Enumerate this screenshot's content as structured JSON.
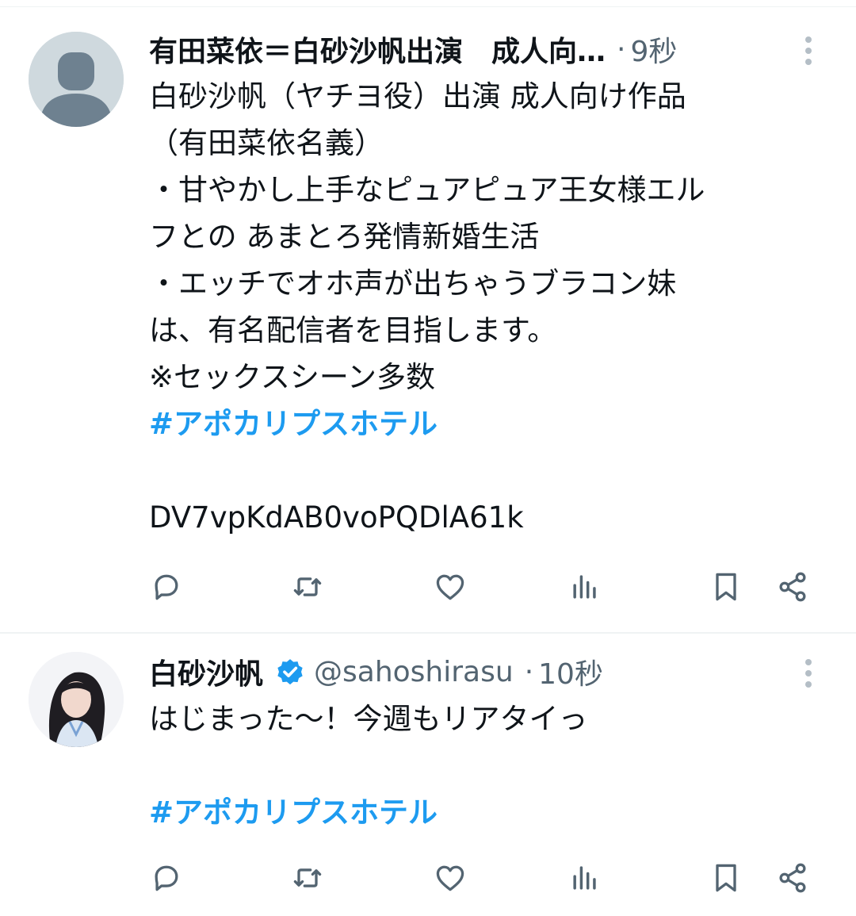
{
  "posts": [
    {
      "author": {
        "display_name": "有田菜依＝白砂沙帆出演　成人向…",
        "handle": "",
        "verified": false,
        "avatar": "default-avatar"
      },
      "separator": "·",
      "timestamp": "9秒",
      "lines": [
        "白砂沙帆（ヤチヨ役）出演 成人向け作品",
        "（有田菜依名義）",
        "・甘やかし上手なピュアピュア王女様エル",
        "フとの あまとろ発情新婚生活",
        "・エッチでオホ声が出ちゃうブラコン妹",
        "は、有名配信者を目指します。",
        "※セックスシーン多数"
      ],
      "hashtag": "#アポカリプスホテル",
      "trailing_text": "DV7vpKdAB0voPQDlA61k"
    },
    {
      "author": {
        "display_name": "白砂沙帆",
        "handle": "@sahoshirasu",
        "verified": true,
        "avatar": "profile-photo"
      },
      "separator": "·",
      "timestamp": "10秒",
      "lines": [
        "はじまった〜！今週もリアタイっ"
      ],
      "hashtag": "#アポカリプスホテル"
    }
  ],
  "icons": {
    "reply": "reply-icon",
    "repost": "repost-icon",
    "like": "like-icon",
    "views": "views-icon",
    "bookmark": "bookmark-icon",
    "share": "share-icon",
    "more": "more-vertical-icon",
    "verified": "verified-badge-icon"
  },
  "colors": {
    "text": "#0f1419",
    "secondary": "#536471",
    "hashtag": "#1d9bf0",
    "verified": "#1d9bf0",
    "divider": "#eff3f4"
  }
}
